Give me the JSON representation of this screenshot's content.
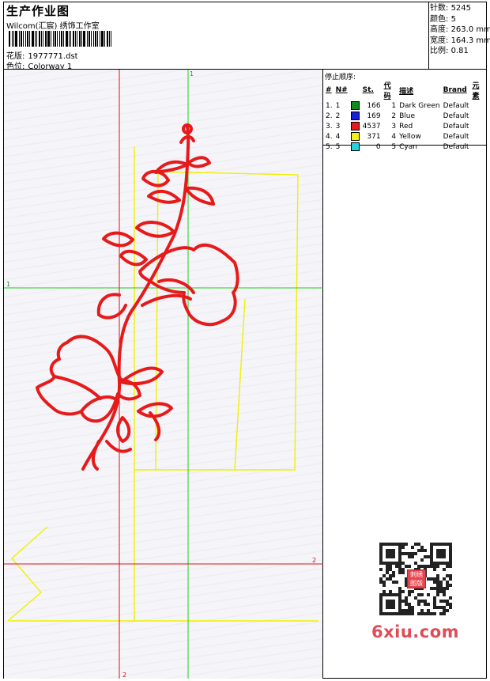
{
  "header": {
    "title": "生产作业图",
    "subtitle": "Wilcom(汇宸) 绣饰工作室",
    "design_label": "花版:",
    "design_value": "1977771.dst",
    "colorway_label": "色位:",
    "colorway_value": "Colorway 1"
  },
  "stats": [
    {
      "label": "针数:",
      "value": "5245"
    },
    {
      "label": "颜色:",
      "value": "5"
    },
    {
      "label": "高度:",
      "value": "263.0 mm"
    },
    {
      "label": "宽度:",
      "value": "164.3 mm"
    },
    {
      "label": "比例:",
      "value": "0.81"
    }
  ],
  "threads": {
    "caption": "停止顺序:",
    "columns": [
      "#",
      "N#",
      "St.",
      "代码",
      "描述",
      "Brand",
      "元素"
    ],
    "rows": [
      {
        "idx": "1.",
        "n": "1",
        "color": "#118a1e",
        "st": "166",
        "code": "1",
        "desc": "Dark Green",
        "brand": "Default"
      },
      {
        "idx": "2.",
        "n": "2",
        "color": "#1b20d8",
        "st": "169",
        "code": "2",
        "desc": "Blue",
        "brand": "Default"
      },
      {
        "idx": "3.",
        "n": "3",
        "color": "#e61a1a",
        "st": "4537",
        "code": "3",
        "desc": "Red",
        "brand": "Default"
      },
      {
        "idx": "4.",
        "n": "4",
        "color": "#f4f01a",
        "st": "371",
        "code": "4",
        "desc": "Yellow",
        "brand": "Default"
      },
      {
        "idx": "5.",
        "n": "5",
        "color": "#23d3e0",
        "st": "0",
        "code": "5",
        "desc": "Cyan",
        "brand": "Default"
      }
    ]
  },
  "guides": {
    "green_v_label": "1",
    "green_h_label": "1",
    "red_h_label": "2",
    "red_v_label": "2",
    "green": "#22cc22",
    "red": "#e01010",
    "yellow": "#f0f000"
  },
  "watermark": {
    "text": "6xiu.com",
    "seal_text": "刺绣图版"
  }
}
